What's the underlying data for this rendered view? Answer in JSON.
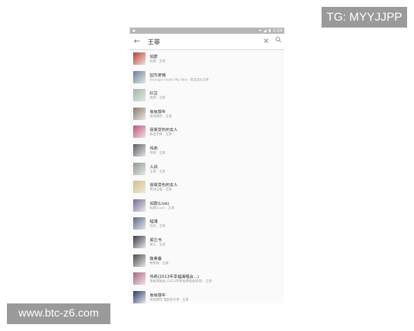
{
  "watermarks": {
    "top_right": "TG: MYYJJPP",
    "bottom_left": "www.btc-z6.com"
  },
  "status_bar": {
    "time": "2:54"
  },
  "search": {
    "query": "王菲"
  },
  "songs": [
    {
      "title": "如愿",
      "subtitle": "如愿 · 王菲",
      "thumb_color": "#c0392b"
    },
    {
      "title": "因为爱情",
      "subtitle": "Stronger Under My Skin · 陈奕迅&王菲",
      "thumb_color": "#6a7f9a"
    },
    {
      "title": "红豆",
      "subtitle": "唱游 · 王菲",
      "thumb_color": "#a0b5a8"
    },
    {
      "title": "匆匆那年",
      "subtitle": "匆匆那年 · 王菲",
      "thumb_color": "#8a7a6a"
    },
    {
      "title": "容易受伤的女人",
      "subtitle": "执迷不悔 · 王菲",
      "thumb_color": "#c0507a"
    },
    {
      "title": "传奇",
      "subtitle": "传奇 · 王菲",
      "thumb_color": "#5a5a62"
    },
    {
      "title": "人间",
      "subtitle": "王菲 · 王菲",
      "thumb_color": "#8a9a8a"
    },
    {
      "title": "容易受伤的女人",
      "subtitle": "粤语全集 · 王菲",
      "thumb_color": "#d9c07a"
    },
    {
      "title": "如愿(Live)",
      "subtitle": "如愿(Live) · 王菲",
      "thumb_color": "#7a6a9a"
    },
    {
      "title": "暗涌",
      "subtitle": "玩具 · 王菲",
      "thumb_color": "#5a6a8a"
    },
    {
      "title": "笑忘书",
      "subtitle": "寓言 · 王菲",
      "thumb_color": "#3a3a4a"
    },
    {
      "title": "致青春",
      "subtitle": "致青春 · 王菲",
      "thumb_color": "#4a4a4a"
    },
    {
      "title": "传奇(2013年幸福演唱会...)",
      "subtitle": "幸福演唱会 (2013年幸福演唱会现场) · 王菲",
      "thumb_color": "#b06080"
    },
    {
      "title": "匆匆那年",
      "subtitle": "匆匆那年 电影原声带 · 王菲",
      "thumb_color": "#2a3a6a"
    }
  ]
}
